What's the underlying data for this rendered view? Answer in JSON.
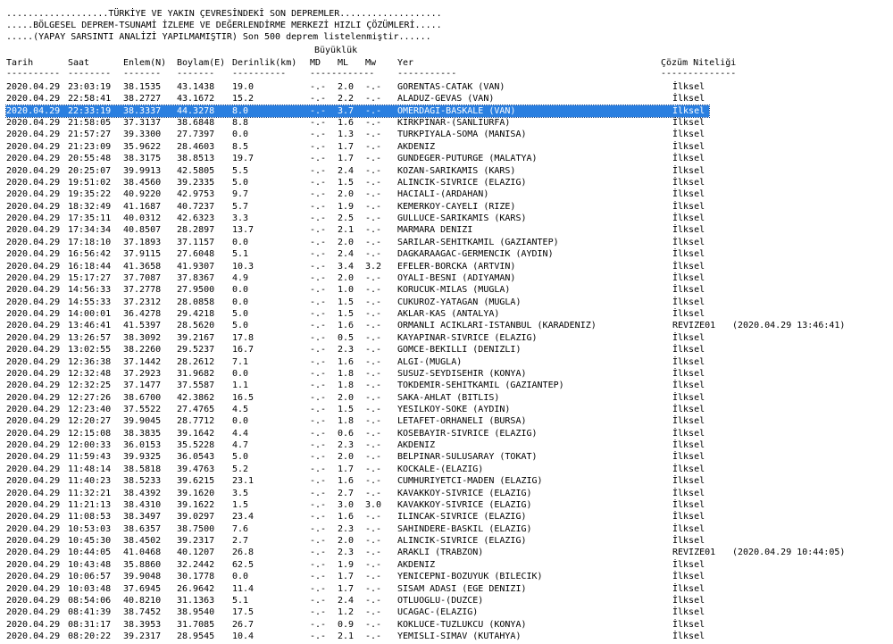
{
  "header": {
    "line1": "...................TÜRKİYE VE YAKIN ÇEVRESİNDEKİ SON DEPREMLER...................",
    "line2": ".....BÖLGESEL DEPREM-TSUNAMİ İZLEME VE DEĞERLENDİRME MERKEZİ HIZLI ÇÖZÜMLERİ.....",
    "line3": ".....(YAPAY SARSINTI ANALİZİ YAPILMAMIŞTIR) Son 500 deprem listelenmiştir......"
  },
  "columns": {
    "buyukluk": "Büyüklük",
    "tarih": "Tarih",
    "saat": "Saat",
    "enlem": "Enlem(N)",
    "boylam": "Boylam(E)",
    "derinlik": "Derinlik(km)",
    "md": "MD",
    "ml": "ML",
    "mw": "Mw",
    "yer": "Yer",
    "cozum": "Çözüm Niteliği"
  },
  "dashes": {
    "tarih": "----------",
    "saat": "--------",
    "enlem": "-------",
    "boylam": "-------",
    "derinlik": "----------",
    "mag": "------------",
    "yer": "-----------",
    "cozum": "--------------"
  },
  "selected_row": 2,
  "rows": [
    {
      "date": "2020.04.29",
      "time": "23:03:19",
      "lat": "38.1535",
      "lon": "43.1438",
      "depth": "19.0",
      "md": "-.-",
      "ml": "2.0",
      "mw": "-.-",
      "place": "GORENTAS-CATAK (VAN)",
      "quality": "İlksel"
    },
    {
      "date": "2020.04.29",
      "time": "22:58:41",
      "lat": "38.2727",
      "lon": "43.1672",
      "depth": "15.2",
      "md": "-.-",
      "ml": "2.2",
      "mw": "-.-",
      "place": "ALADUZ-GEVAS (VAN)",
      "quality": "İlksel"
    },
    {
      "date": "2020.04.29",
      "time": "22:33:19",
      "lat": "38.3337",
      "lon": "44.3278",
      "depth": "8.0",
      "md": "-.-",
      "ml": "3.7",
      "mw": "-.-",
      "place": "OMERDAGI-BASKALE (VAN)",
      "quality": "İlksel"
    },
    {
      "date": "2020.04.29",
      "time": "21:58:05",
      "lat": "37.3137",
      "lon": "38.6848",
      "depth": "8.8",
      "md": "-.-",
      "ml": "1.6",
      "mw": "-.-",
      "place": "KIRKPINAR-(SANLIURFA)",
      "quality": "İlksel"
    },
    {
      "date": "2020.04.29",
      "time": "21:57:27",
      "lat": "39.3300",
      "lon": "27.7397",
      "depth": "0.0",
      "md": "-.-",
      "ml": "1.3",
      "mw": "-.-",
      "place": "TURKPIYALA-SOMA (MANISA)",
      "quality": "İlksel"
    },
    {
      "date": "2020.04.29",
      "time": "21:23:09",
      "lat": "35.9622",
      "lon": "28.4603",
      "depth": "8.5",
      "md": "-.-",
      "ml": "1.7",
      "mw": "-.-",
      "place": "AKDENIZ",
      "quality": "İlksel"
    },
    {
      "date": "2020.04.29",
      "time": "20:55:48",
      "lat": "38.3175",
      "lon": "38.8513",
      "depth": "19.7",
      "md": "-.-",
      "ml": "1.7",
      "mw": "-.-",
      "place": "GUNDEGER-PUTURGE (MALATYA)",
      "quality": "İlksel"
    },
    {
      "date": "2020.04.29",
      "time": "20:25:07",
      "lat": "39.9913",
      "lon": "42.5805",
      "depth": "5.5",
      "md": "-.-",
      "ml": "2.4",
      "mw": "-.-",
      "place": "KOZAN-SARIKAMIS (KARS)",
      "quality": "İlksel"
    },
    {
      "date": "2020.04.29",
      "time": "19:51:02",
      "lat": "38.4560",
      "lon": "39.2335",
      "depth": "5.0",
      "md": "-.-",
      "ml": "1.5",
      "mw": "-.-",
      "place": "ALINCIK-SIVRICE (ELAZIG)",
      "quality": "İlksel"
    },
    {
      "date": "2020.04.29",
      "time": "19:35:22",
      "lat": "40.9220",
      "lon": "42.9753",
      "depth": "9.7",
      "md": "-.-",
      "ml": "2.0",
      "mw": "-.-",
      "place": "HACIALI-(ARDAHAN)",
      "quality": "İlksel"
    },
    {
      "date": "2020.04.29",
      "time": "18:32:49",
      "lat": "41.1687",
      "lon": "40.7237",
      "depth": "5.7",
      "md": "-.-",
      "ml": "1.9",
      "mw": "-.-",
      "place": "KEMERKOY-CAYELI (RIZE)",
      "quality": "İlksel"
    },
    {
      "date": "2020.04.29",
      "time": "17:35:11",
      "lat": "40.0312",
      "lon": "42.6323",
      "depth": "3.3",
      "md": "-.-",
      "ml": "2.5",
      "mw": "-.-",
      "place": "GULLUCE-SARIKAMIS (KARS)",
      "quality": "İlksel"
    },
    {
      "date": "2020.04.29",
      "time": "17:34:34",
      "lat": "40.8507",
      "lon": "28.2897",
      "depth": "13.7",
      "md": "-.-",
      "ml": "2.1",
      "mw": "-.-",
      "place": "MARMARA DENIZI",
      "quality": "İlksel"
    },
    {
      "date": "2020.04.29",
      "time": "17:18:10",
      "lat": "37.1893",
      "lon": "37.1157",
      "depth": "0.0",
      "md": "-.-",
      "ml": "2.0",
      "mw": "-.-",
      "place": "SARILAR-SEHITKAMIL (GAZIANTEP)",
      "quality": "İlksel"
    },
    {
      "date": "2020.04.29",
      "time": "16:56:42",
      "lat": "37.9115",
      "lon": "27.6048",
      "depth": "5.1",
      "md": "-.-",
      "ml": "2.4",
      "mw": "-.-",
      "place": "DAGKARAAGAC-GERMENCIK (AYDIN)",
      "quality": "İlksel"
    },
    {
      "date": "2020.04.29",
      "time": "16:18:44",
      "lat": "41.3658",
      "lon": "41.9307",
      "depth": "10.3",
      "md": "-.-",
      "ml": "3.4",
      "mw": "3.2",
      "place": "EFELER-BORCKA (ARTVIN)",
      "quality": "İlksel"
    },
    {
      "date": "2020.04.29",
      "time": "15:17:27",
      "lat": "37.7087",
      "lon": "37.8367",
      "depth": "4.9",
      "md": "-.-",
      "ml": "2.0",
      "mw": "-.-",
      "place": "OYALI-BESNI (ADIYAMAN)",
      "quality": "İlksel"
    },
    {
      "date": "2020.04.29",
      "time": "14:56:33",
      "lat": "37.2778",
      "lon": "27.9500",
      "depth": "0.0",
      "md": "-.-",
      "ml": "1.0",
      "mw": "-.-",
      "place": "KORUCUK-MILAS (MUGLA)",
      "quality": "İlksel"
    },
    {
      "date": "2020.04.29",
      "time": "14:55:33",
      "lat": "37.2312",
      "lon": "28.0858",
      "depth": "0.0",
      "md": "-.-",
      "ml": "1.5",
      "mw": "-.-",
      "place": "CUKUROZ-YATAGAN (MUGLA)",
      "quality": "İlksel"
    },
    {
      "date": "2020.04.29",
      "time": "14:00:01",
      "lat": "36.4278",
      "lon": "29.4218",
      "depth": "5.0",
      "md": "-.-",
      "ml": "1.5",
      "mw": "-.-",
      "place": "AKLAR-KAS (ANTALYA)",
      "quality": "İlksel"
    },
    {
      "date": "2020.04.29",
      "time": "13:46:41",
      "lat": "41.5397",
      "lon": "28.5620",
      "depth": "5.0",
      "md": "-.-",
      "ml": "1.6",
      "mw": "-.-",
      "place": "ORMANLI ACIKLARI-ISTANBUL (KARADENIZ)",
      "quality": "REVIZE01",
      "revised": "(2020.04.29 13:46:41)"
    },
    {
      "date": "2020.04.29",
      "time": "13:26:57",
      "lat": "38.3092",
      "lon": "39.2167",
      "depth": "17.8",
      "md": "-.-",
      "ml": "0.5",
      "mw": "-.-",
      "place": "KAYAPINAR-SIVRICE (ELAZIG)",
      "quality": "İlksel"
    },
    {
      "date": "2020.04.29",
      "time": "13:02:55",
      "lat": "38.2260",
      "lon": "29.5237",
      "depth": "16.7",
      "md": "-.-",
      "ml": "2.3",
      "mw": "-.-",
      "place": "GOMCE-BEKILLI (DENIZLI)",
      "quality": "İlksel"
    },
    {
      "date": "2020.04.29",
      "time": "12:36:38",
      "lat": "37.1442",
      "lon": "28.2612",
      "depth": "7.1",
      "md": "-.-",
      "ml": "1.6",
      "mw": "-.-",
      "place": "ALGI-(MUGLA)",
      "quality": "İlksel"
    },
    {
      "date": "2020.04.29",
      "time": "12:32:48",
      "lat": "37.2923",
      "lon": "31.9682",
      "depth": "0.0",
      "md": "-.-",
      "ml": "1.8",
      "mw": "-.-",
      "place": "SUSUZ-SEYDISEHIR (KONYA)",
      "quality": "İlksel"
    },
    {
      "date": "2020.04.29",
      "time": "12:32:25",
      "lat": "37.1477",
      "lon": "37.5587",
      "depth": "1.1",
      "md": "-.-",
      "ml": "1.8",
      "mw": "-.-",
      "place": "TOKDEMIR-SEHITKAMIL (GAZIANTEP)",
      "quality": "İlksel"
    },
    {
      "date": "2020.04.29",
      "time": "12:27:26",
      "lat": "38.6700",
      "lon": "42.3862",
      "depth": "16.5",
      "md": "-.-",
      "ml": "2.0",
      "mw": "-.-",
      "place": "SAKA-AHLAT (BITLIS)",
      "quality": "İlksel"
    },
    {
      "date": "2020.04.29",
      "time": "12:23:40",
      "lat": "37.5522",
      "lon": "27.4765",
      "depth": "4.5",
      "md": "-.-",
      "ml": "1.5",
      "mw": "-.-",
      "place": "YESILKOY-SOKE (AYDIN)",
      "quality": "İlksel"
    },
    {
      "date": "2020.04.29",
      "time": "12:20:27",
      "lat": "39.9045",
      "lon": "28.7712",
      "depth": "0.0",
      "md": "-.-",
      "ml": "1.8",
      "mw": "-.-",
      "place": "LETAFET-ORHANELI (BURSA)",
      "quality": "İlksel"
    },
    {
      "date": "2020.04.29",
      "time": "12:15:08",
      "lat": "38.3835",
      "lon": "39.1642",
      "depth": "4.4",
      "md": "-.-",
      "ml": "0.6",
      "mw": "-.-",
      "place": "KOSEBAYIR-SIVRICE (ELAZIG)",
      "quality": "İlksel"
    },
    {
      "date": "2020.04.29",
      "time": "12:00:33",
      "lat": "36.0153",
      "lon": "35.5228",
      "depth": "4.7",
      "md": "-.-",
      "ml": "2.3",
      "mw": "-.-",
      "place": "AKDENIZ",
      "quality": "İlksel"
    },
    {
      "date": "2020.04.29",
      "time": "11:59:43",
      "lat": "39.9325",
      "lon": "36.0543",
      "depth": "5.0",
      "md": "-.-",
      "ml": "2.0",
      "mw": "-.-",
      "place": "BELPINAR-SULUSARAY (TOKAT)",
      "quality": "İlksel"
    },
    {
      "date": "2020.04.29",
      "time": "11:48:14",
      "lat": "38.5818",
      "lon": "39.4763",
      "depth": "5.2",
      "md": "-.-",
      "ml": "1.7",
      "mw": "-.-",
      "place": "KOCKALE-(ELAZIG)",
      "quality": "İlksel"
    },
    {
      "date": "2020.04.29",
      "time": "11:40:23",
      "lat": "38.5233",
      "lon": "39.6215",
      "depth": "23.1",
      "md": "-.-",
      "ml": "1.6",
      "mw": "-.-",
      "place": "CUMHURIYETCI-MADEN (ELAZIG)",
      "quality": "İlksel"
    },
    {
      "date": "2020.04.29",
      "time": "11:32:21",
      "lat": "38.4392",
      "lon": "39.1620",
      "depth": "3.5",
      "md": "-.-",
      "ml": "2.7",
      "mw": "-.-",
      "place": "KAVAKKOY-SIVRICE (ELAZIG)",
      "quality": "İlksel"
    },
    {
      "date": "2020.04.29",
      "time": "11:21:13",
      "lat": "38.4310",
      "lon": "39.1622",
      "depth": "1.5",
      "md": "-.-",
      "ml": "3.0",
      "mw": "3.0",
      "place": "KAVAKKOY-SIVRICE (ELAZIG)",
      "quality": "İlksel"
    },
    {
      "date": "2020.04.29",
      "time": "11:08:53",
      "lat": "38.3497",
      "lon": "39.0297",
      "depth": "23.4",
      "md": "-.-",
      "ml": "1.6",
      "mw": "-.-",
      "place": "ILINCAK-SIVRICE (ELAZIG)",
      "quality": "İlksel"
    },
    {
      "date": "2020.04.29",
      "time": "10:53:03",
      "lat": "38.6357",
      "lon": "38.7500",
      "depth": "7.6",
      "md": "-.-",
      "ml": "2.3",
      "mw": "-.-",
      "place": "SAHINDERE-BASKIL (ELAZIG)",
      "quality": "İlksel"
    },
    {
      "date": "2020.04.29",
      "time": "10:45:30",
      "lat": "38.4502",
      "lon": "39.2317",
      "depth": "2.7",
      "md": "-.-",
      "ml": "2.0",
      "mw": "-.-",
      "place": "ALINCIK-SIVRICE (ELAZIG)",
      "quality": "İlksel"
    },
    {
      "date": "2020.04.29",
      "time": "10:44:05",
      "lat": "41.0468",
      "lon": "40.1207",
      "depth": "26.8",
      "md": "-.-",
      "ml": "2.3",
      "mw": "-.-",
      "place": "ARAKLI (TRABZON)",
      "quality": "REVIZE01",
      "revised": "(2020.04.29 10:44:05)"
    },
    {
      "date": "2020.04.29",
      "time": "10:43:48",
      "lat": "35.8860",
      "lon": "32.2442",
      "depth": "62.5",
      "md": "-.-",
      "ml": "1.9",
      "mw": "-.-",
      "place": "AKDENIZ",
      "quality": "İlksel"
    },
    {
      "date": "2020.04.29",
      "time": "10:06:57",
      "lat": "39.9048",
      "lon": "30.1778",
      "depth": "0.0",
      "md": "-.-",
      "ml": "1.7",
      "mw": "-.-",
      "place": "YENICEPNI-BOZUYUK (BILECIK)",
      "quality": "İlksel"
    },
    {
      "date": "2020.04.29",
      "time": "10:03:48",
      "lat": "37.6945",
      "lon": "26.9642",
      "depth": "11.4",
      "md": "-.-",
      "ml": "1.7",
      "mw": "-.-",
      "place": "SISAM ADASI (EGE DENIZI)",
      "quality": "İlksel"
    },
    {
      "date": "2020.04.29",
      "time": "08:54:06",
      "lat": "40.8210",
      "lon": "31.1363",
      "depth": "5.1",
      "md": "-.-",
      "ml": "2.4",
      "mw": "-.-",
      "place": "OTLUOGLU-(DUZCE)",
      "quality": "İlksel"
    },
    {
      "date": "2020.04.29",
      "time": "08:41:39",
      "lat": "38.7452",
      "lon": "38.9540",
      "depth": "17.5",
      "md": "-.-",
      "ml": "1.2",
      "mw": "-.-",
      "place": "UCAGAC-(ELAZIG)",
      "quality": "İlksel"
    },
    {
      "date": "2020.04.29",
      "time": "08:31:17",
      "lat": "38.3953",
      "lon": "31.7085",
      "depth": "26.7",
      "md": "-.-",
      "ml": "0.9",
      "mw": "-.-",
      "place": "KOKLUCE-TUZLUKCU (KONYA)",
      "quality": "İlksel"
    },
    {
      "date": "2020.04.29",
      "time": "08:20:22",
      "lat": "39.2317",
      "lon": "28.9545",
      "depth": "10.4",
      "md": "-.-",
      "ml": "2.1",
      "mw": "-.-",
      "place": "YEMISLI-SIMAV (KUTAHYA)",
      "quality": "İlksel"
    }
  ]
}
